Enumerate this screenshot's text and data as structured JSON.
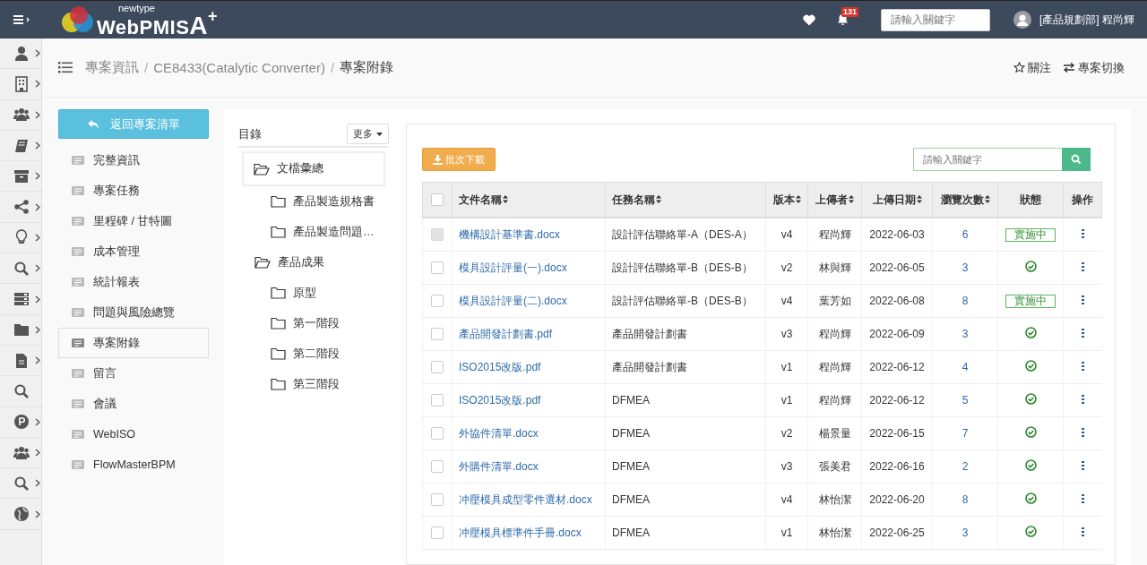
{
  "header": {
    "logo": {
      "small": "newtype",
      "name": "WebPMIS",
      "mark": "A",
      "sup": "+"
    },
    "notifications": "131",
    "search": {
      "placeholder": "請輸入關鍵字"
    },
    "user": "[產品規劃部] 程尚輝"
  },
  "rail": [
    {
      "expandable": true
    },
    {
      "expandable": true
    },
    {
      "expandable": true
    },
    {
      "expandable": true
    },
    {
      "expandable": true
    },
    {
      "expandable": true
    },
    {
      "expandable": true
    },
    {
      "expandable": true
    },
    {
      "expandable": true
    },
    {
      "expandable": true
    },
    {
      "expandable": true
    },
    {
      "expandable": false
    },
    {
      "expandable": true
    },
    {
      "expandable": true
    },
    {
      "expandable": true
    },
    {
      "expandable": true
    }
  ],
  "breadcrumb": {
    "separator": "/",
    "items": [
      "專案資訊",
      "CE8433(Catalytic Converter)",
      "專案附錄"
    ]
  },
  "page_actions": [
    "關注",
    "專案切換"
  ],
  "back_button": "返回專案清單",
  "menu": [
    {
      "label": "完整資訊",
      "selected": false
    },
    {
      "label": "專案任務",
      "selected": false
    },
    {
      "label": "里程碑 / 甘特圖",
      "selected": false
    },
    {
      "label": "成本管理",
      "selected": false
    },
    {
      "label": "統計報表",
      "selected": false
    },
    {
      "label": "問題與風險總覽",
      "selected": false
    },
    {
      "label": "專案附錄",
      "selected": true
    },
    {
      "label": "留言",
      "selected": false
    },
    {
      "label": "會議",
      "selected": false
    },
    {
      "label": "WebISO",
      "selected": false
    },
    {
      "label": "FlowMasterBPM",
      "selected": false
    }
  ],
  "tree": {
    "title": "目錄",
    "more_button": "更多",
    "items": [
      {
        "label": "文檔彙總",
        "selected": true,
        "expanded": true,
        "children": [
          {
            "label": "產品製造規格書",
            "selected": false
          },
          {
            "label": "產品製造問題…",
            "selected": false
          }
        ]
      },
      {
        "label": "產品成果",
        "selected": false,
        "expanded": true,
        "children": [
          {
            "label": "原型",
            "selected": false
          },
          {
            "label": "第一階段",
            "selected": false
          },
          {
            "label": "第二階段",
            "selected": false
          },
          {
            "label": "第三階段",
            "selected": false
          }
        ]
      }
    ]
  },
  "batch_download": "批次下載",
  "table_search": {
    "placeholder": "請輸入關鍵字"
  },
  "table": {
    "select_all_checked": false,
    "columns": [
      {
        "label": "文件名稱",
        "sortable": true
      },
      {
        "label": "任務名稱",
        "sortable": true
      },
      {
        "label": "版本",
        "sortable": true
      },
      {
        "label": "上傳者",
        "sortable": true
      },
      {
        "label": "上傳日期",
        "sortable": true
      },
      {
        "label": "瀏覽次數",
        "sortable": true
      },
      {
        "label": "狀態",
        "sortable": false
      },
      {
        "label": "操作",
        "sortable": false
      }
    ],
    "rows": [
      {
        "checked": false,
        "disabled": true,
        "file": "機構設計基準書.docx",
        "task": "設計評估聯絡單-A（DES-A）",
        "version": "v4",
        "uploader": "程尚輝",
        "date": "2022-06-03",
        "views": "6",
        "status": {
          "kind": "badge",
          "text": "實施中"
        }
      },
      {
        "checked": false,
        "disabled": false,
        "file": "模具設計評量(一).docx",
        "task": "設計評估聯絡單-B（DES-B）",
        "version": "v2",
        "uploader": "林與輝",
        "date": "2022-06-05",
        "views": "3",
        "status": {
          "kind": "done"
        }
      },
      {
        "checked": false,
        "disabled": false,
        "file": "模具設計評量(二).docx",
        "task": "設計評估聯絡單-B（DES-B）",
        "version": "v4",
        "uploader": "葉芳如",
        "date": "2022-06-08",
        "views": "8",
        "status": {
          "kind": "badge",
          "text": "實施中"
        }
      },
      {
        "checked": false,
        "disabled": false,
        "file": "產品開發計劃書.pdf",
        "task": "產品開發計劃書",
        "version": "v3",
        "uploader": "程尚輝",
        "date": "2022-06-09",
        "views": "3",
        "status": {
          "kind": "done"
        }
      },
      {
        "checked": false,
        "disabled": false,
        "file": "ISO2015改版.pdf",
        "task": "產品開發計劃書",
        "version": "v1",
        "uploader": "程尚輝",
        "date": "2022-06-12",
        "views": "4",
        "status": {
          "kind": "done"
        }
      },
      {
        "checked": false,
        "disabled": false,
        "file": "ISO2015改版.pdf",
        "task": "DFMEA",
        "version": "v1",
        "uploader": "程尚輝",
        "date": "2022-06-12",
        "views": "5",
        "status": {
          "kind": "done"
        }
      },
      {
        "checked": false,
        "disabled": false,
        "file": "外協件清單.docx",
        "task": "DFMEA",
        "version": "v2",
        "uploader": "楊景量",
        "date": "2022-06-15",
        "views": "7",
        "status": {
          "kind": "done"
        }
      },
      {
        "checked": false,
        "disabled": false,
        "file": "外購件清單.docx",
        "task": "DFMEA",
        "version": "v3",
        "uploader": "張美君",
        "date": "2022-06-16",
        "views": "2",
        "status": {
          "kind": "done"
        }
      },
      {
        "checked": false,
        "disabled": false,
        "file": "冲壓模具成型零件選材.docx",
        "task": "DFMEA",
        "version": "v4",
        "uploader": "林怡潔",
        "date": "2022-06-20",
        "views": "8",
        "status": {
          "kind": "done"
        }
      },
      {
        "checked": false,
        "disabled": false,
        "file": "冲壓模具標準件手冊.docx",
        "task": "DFMEA",
        "version": "v1",
        "uploader": "林怡潔",
        "date": "2022-06-25",
        "views": "3",
        "status": {
          "kind": "done"
        }
      }
    ]
  }
}
